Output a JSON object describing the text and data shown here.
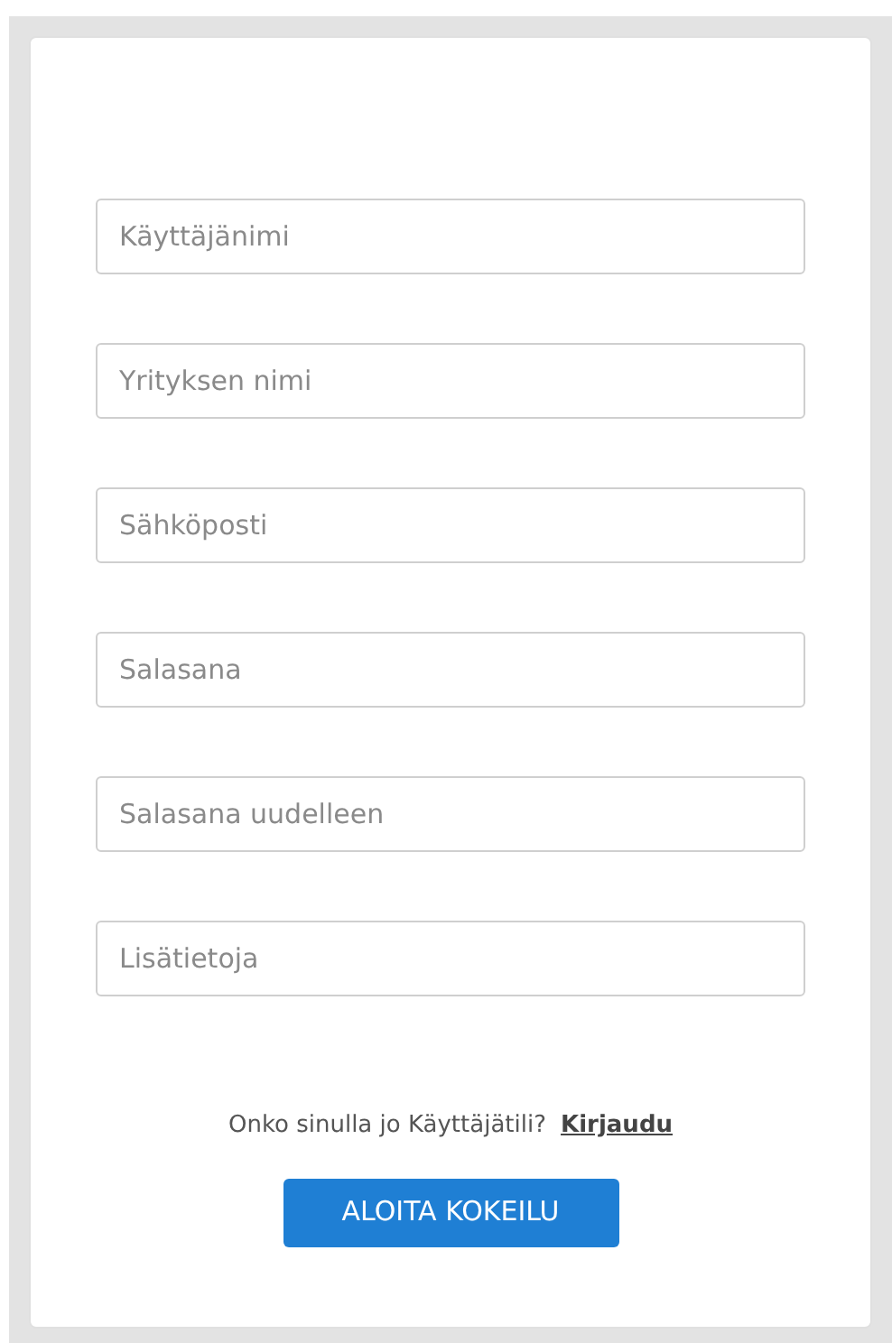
{
  "fields": [
    {
      "placeholder": "Käyttäjänimi"
    },
    {
      "placeholder": "Yrityksen nimi"
    },
    {
      "placeholder": "Sähköposti"
    },
    {
      "placeholder": "Salasana"
    },
    {
      "placeholder": "Salasana uudelleen"
    },
    {
      "placeholder": "Lisätietoja"
    }
  ],
  "login_prompt": {
    "text": "Onko sinulla jo Käyttäjätili?",
    "link": "Kirjaudu"
  },
  "submit_button": "ALOITA KOKEILU"
}
